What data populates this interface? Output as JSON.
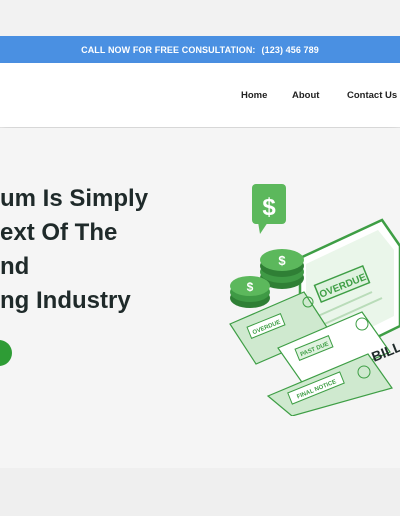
{
  "topbar": {
    "text": "CALL NOW FOR FREE CONSULTATION:",
    "phone": "(123) 456 789",
    "color": "#4a90e2"
  },
  "nav": {
    "items": [
      "Home",
      "About",
      "Contact Us"
    ]
  },
  "hero": {
    "headline_lines": [
      "um Is Simply",
      "ext Of The",
      "nd",
      "ng Industry"
    ],
    "illustration": {
      "badge_icon": "dollar-icon",
      "labels": [
        "OVERDUE",
        "OVERDUE",
        "PAST DUE",
        "FINAL NOTICE",
        "BILL"
      ]
    },
    "accent": "#2e9c35"
  }
}
